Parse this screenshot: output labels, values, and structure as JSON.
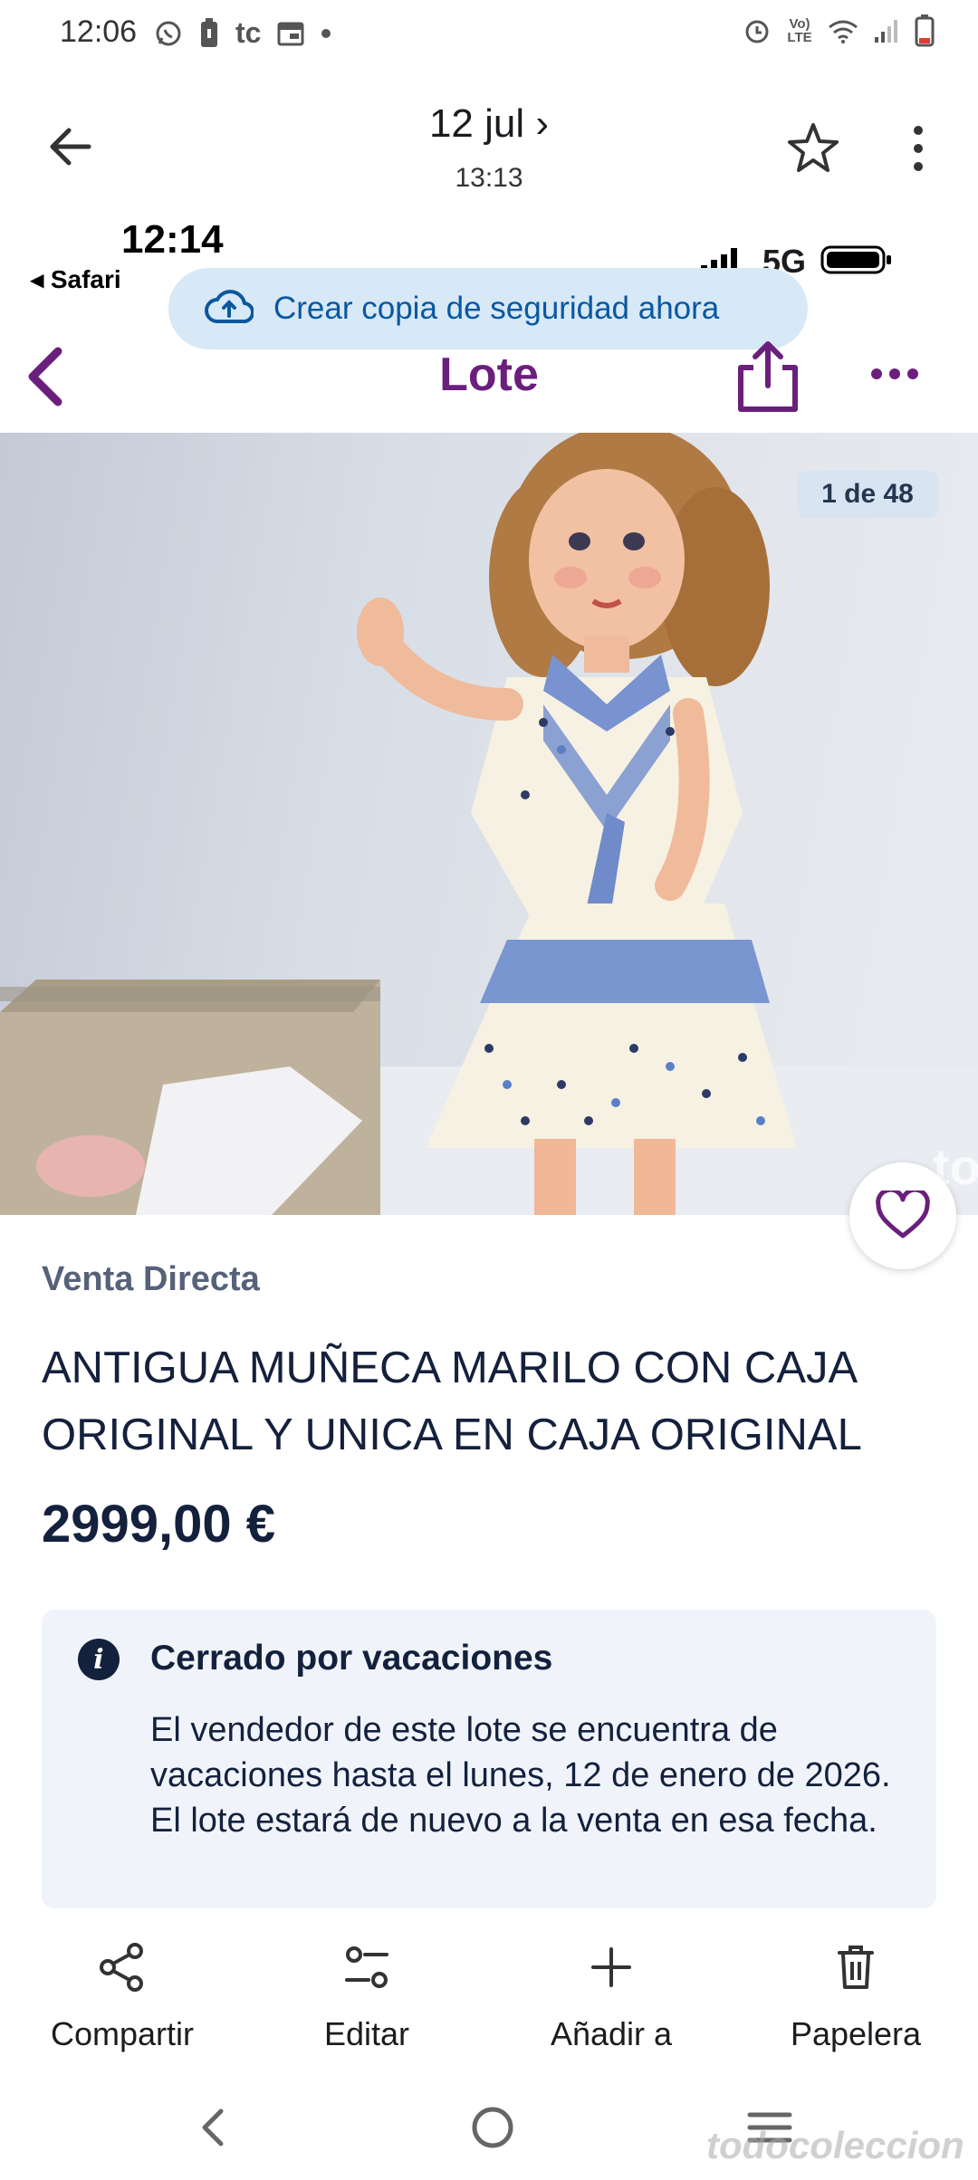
{
  "status_bar": {
    "time": "12:06",
    "left_icons": [
      "whatsapp-icon",
      "battery-saver-icon",
      "tc-app-icon",
      "calendar-icon",
      "dot-icon"
    ],
    "right_icons": [
      "alarm-icon",
      "volte-icon",
      "wifi-icon",
      "signal-icon",
      "battery-icon"
    ],
    "tc_label": "tc",
    "volte_label": "Vo) LTE"
  },
  "gallery_header": {
    "date": "12 jul ›",
    "time": "13:13"
  },
  "screenshot": {
    "ios_time": "12:14",
    "ios_back_app": "◂ Safari",
    "ios_network": "5G",
    "backup_banner": "Crear copia de seguridad ahora",
    "page_title": "Lote",
    "image_counter": "1 de 48",
    "sale_type": "Venta Directa",
    "product_title": "ANTIGUA MUÑECA MARILO CON CAJA ORIGINAL Y UNICA EN CAJA ORIGINAL",
    "price": "2999,00 €",
    "notice": {
      "title": "Cerrado por vacaciones",
      "body": "El vendedor de este lote se encuentra de vacaciones hasta el lunes, 12 de enero de 2026. El lote estará de nuevo a la venta en esa fecha."
    },
    "watermark": "to",
    "watermark_bottom": "todocoleccion"
  },
  "actions": [
    {
      "label": "Compartir",
      "icon": "share-icon"
    },
    {
      "label": "Editar",
      "icon": "edit-sliders-icon"
    },
    {
      "label": "Añadir a",
      "icon": "plus-icon"
    },
    {
      "label": "Papelera",
      "icon": "trash-icon"
    }
  ],
  "colors": {
    "brand_purple": "#6b1f7c",
    "banner_blue": "#0b57a0",
    "navy_text": "#14213d"
  }
}
